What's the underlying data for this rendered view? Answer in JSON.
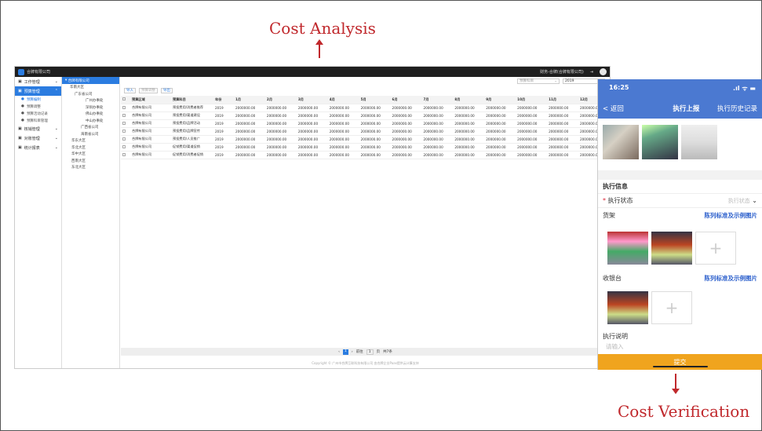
{
  "annotations": {
    "top": "Cost Analysis",
    "bottom": "Cost Verification"
  },
  "desktop": {
    "company": "合牌有限公司",
    "user": "财务-合牌(合牌有限公司)",
    "sidebar": [
      {
        "label": "工作管理",
        "icon": "home-icon"
      },
      {
        "label": "预算管理",
        "icon": "budget-icon",
        "active": true,
        "subs": [
          {
            "label": "预算编制",
            "active": true
          },
          {
            "label": "预算调整"
          },
          {
            "label": "预算活动记录"
          },
          {
            "label": "预算科目管理"
          }
        ]
      },
      {
        "label": "核销管理",
        "icon": "check-icon"
      },
      {
        "label": "对账管理",
        "icon": "reconcile-icon"
      },
      {
        "label": "统计报表",
        "icon": "report-icon"
      }
    ],
    "tree_head": "合牌有限公司",
    "tree": [
      "华南大区",
      "广东省公司",
      "广州办事处",
      "深圳办事处",
      "佛山办事处",
      "中山办事处",
      "广西省公司",
      "海南省公司",
      "华东大区",
      "华北大区",
      "华中大区",
      "西南大区",
      "东北大区"
    ],
    "filter": {
      "subject": "预算科目",
      "year": "2019"
    },
    "toolbar": [
      "导入",
      "预算调整",
      "导出"
    ],
    "columns": [
      "预算区域",
      "预算科目",
      "年份",
      "1月",
      "2月",
      "3月",
      "4月",
      "5月",
      "6月",
      "7月",
      "8月",
      "9月",
      "10月",
      "11月",
      "12月"
    ],
    "rows": [
      {
        "region": "合牌有限公司",
        "subject": "预投费用/消费者推荐",
        "year": "2019"
      },
      {
        "region": "合牌有限公司",
        "subject": "预投费用/渠道建设",
        "year": "2019"
      },
      {
        "region": "合牌有限公司",
        "subject": "预投费用/品牌活动",
        "year": "2019"
      },
      {
        "region": "合牌有限公司",
        "subject": "预投费用/品牌宣传",
        "year": "2019"
      },
      {
        "region": "合牌有限公司",
        "subject": "预投费用/人员推广",
        "year": "2019"
      },
      {
        "region": "合牌有限公司",
        "subject": "促销费用/渠道促销",
        "year": "2019"
      },
      {
        "region": "合牌有限公司",
        "subject": "促销费用/消费者促销",
        "year": "2019"
      }
    ],
    "month_value": "2000000.00",
    "pager": {
      "page": "1",
      "goto": "前往",
      "unit": "页",
      "total": "共7条"
    },
    "copyright": "Copyright © 广州市合牌互联科技有限公司 由合牌企业Paas提供云计算支持"
  },
  "phone": {
    "time": "16:25",
    "signal": ".ıl ᯤ ▬",
    "back": "返回",
    "title": "执行上报",
    "history": "执行历史记录",
    "section": "执行信息",
    "status_label": "执行状态",
    "status_placeholder": "执行状态",
    "shelf_label": "货架",
    "link_text": "陈列标准及示例图片",
    "counter_label": "收银台",
    "note_label": "执行说明",
    "note_placeholder": "请输入",
    "submit": "提交"
  }
}
